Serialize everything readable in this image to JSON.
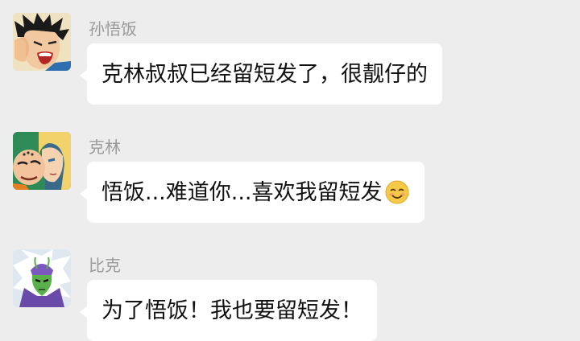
{
  "messages": [
    {
      "sender": "孙悟饭",
      "avatar_icon": "gohan-avatar-icon",
      "text": "克林叔叔已经留短发了，很靓仔的"
    },
    {
      "sender": "克林",
      "avatar_icon": "krillin-and-android18-avatar-icon",
      "text": "悟饭...难道你...喜欢我留短发",
      "emoji": "smiling-face-icon"
    },
    {
      "sender": "比克",
      "avatar_icon": "piccolo-avatar-icon",
      "text": "为了悟饭！我也要留短发！"
    }
  ],
  "colors": {
    "background": "#ededed",
    "bubble": "#ffffff",
    "sender_name": "#9a9a9a",
    "message_text": "#111111"
  }
}
